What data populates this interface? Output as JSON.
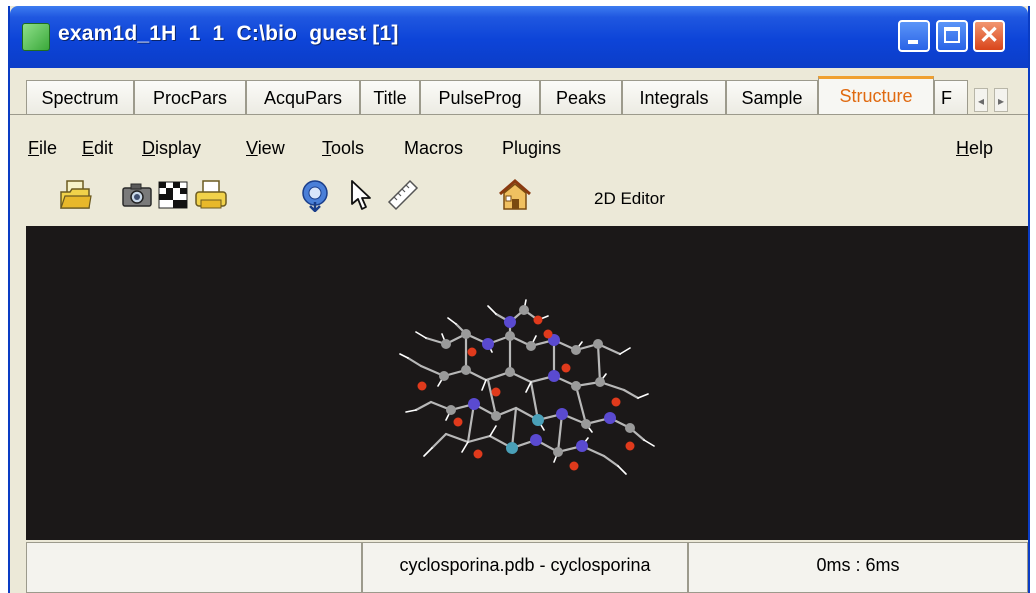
{
  "window": {
    "title": "exam1d_1H  1  1  C:\\bio  guest [1]",
    "title_bar_color": "#0d44d8",
    "close_color": "#d9451b"
  },
  "tabs": [
    {
      "label": "Spectrum",
      "active": false
    },
    {
      "label": "ProcPars",
      "active": false
    },
    {
      "label": "AcquPars",
      "active": false
    },
    {
      "label": "Title",
      "active": false
    },
    {
      "label": "PulseProg",
      "active": false
    },
    {
      "label": "Peaks",
      "active": false
    },
    {
      "label": "Integrals",
      "active": false
    },
    {
      "label": "Sample",
      "active": false
    },
    {
      "label": "Structure",
      "active": true
    },
    {
      "label": "F",
      "active": false
    }
  ],
  "menu": {
    "file": {
      "mnemonic": "F",
      "rest": "ile"
    },
    "edit": {
      "mnemonic": "E",
      "rest": "dit"
    },
    "display": {
      "mnemonic": "D",
      "rest": "isplay"
    },
    "view": {
      "mnemonic": "V",
      "rest": "iew"
    },
    "tools": {
      "mnemonic": "T",
      "rest": "ools"
    },
    "macros": {
      "label": "Macros"
    },
    "plugins": {
      "label": "Plugins"
    },
    "help": {
      "mnemonic": "H",
      "rest": "elp"
    }
  },
  "toolbar": {
    "icons": [
      "open-folder-icon",
      "camera-icon",
      "checkerboard-icon",
      "print-icon",
      "rotate-icon",
      "pointer-icon",
      "ruler-icon",
      "home-icon"
    ],
    "editor_label": "2D Editor"
  },
  "viewer": {
    "background": "#1b1818",
    "atom_colors": {
      "carbon": "#8c8c8c",
      "hydrogen": "#ffffff",
      "oxygen": "#e03a1c",
      "nitrogen": "#5a4ad0"
    }
  },
  "status": {
    "left": "",
    "file": "cyclosporina.pdb - cyclosporina",
    "timing": "0ms :  6ms"
  }
}
